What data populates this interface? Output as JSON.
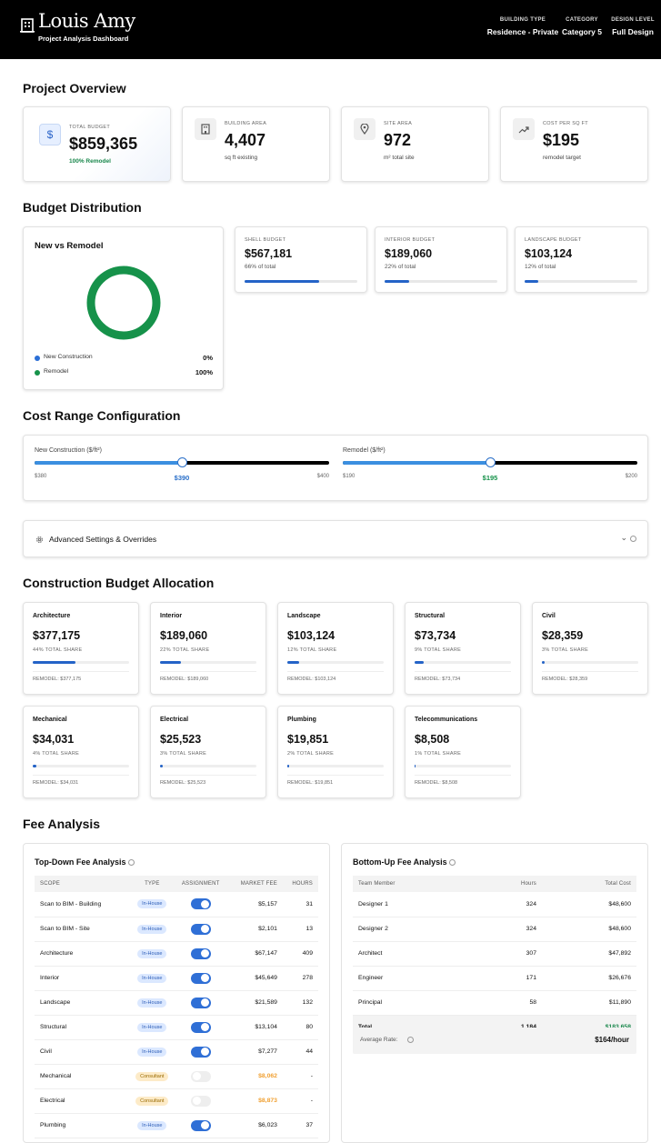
{
  "header": {
    "brand": "Louis Amy",
    "subtitle": "Project Analysis Dashboard",
    "meta": [
      {
        "label": "BUILDING TYPE",
        "value": "Residence - Private"
      },
      {
        "label": "CATEGORY",
        "value": "Category 5"
      },
      {
        "label": "DESIGN LEVEL",
        "value": "Full Design"
      }
    ]
  },
  "overview": {
    "title": "Project Overview",
    "cards": [
      {
        "icon": "dollar-icon",
        "label": "TOTAL BUDGET",
        "value": "$859,365",
        "sub": "100% Remodel"
      },
      {
        "icon": "building-icon",
        "label": "BUILDING AREA",
        "value": "4,407",
        "sub": "sq ft existing"
      },
      {
        "icon": "map-pin-icon",
        "label": "SITE AREA",
        "value": "972",
        "sub": "m² total site"
      },
      {
        "icon": "trending-up-icon",
        "label": "COST PER SQ FT",
        "value": "$195",
        "sub": "remodel target"
      }
    ]
  },
  "budget": {
    "title": "Budget Distribution",
    "donut": {
      "title": "New vs Remodel",
      "legend": [
        {
          "label": "New Construction",
          "value": "0%",
          "color": "#2b6fd6"
        },
        {
          "label": "Remodel",
          "value": "100%",
          "color": "#16924a"
        }
      ],
      "new_fraction": 0,
      "remodel_fraction": 1
    },
    "cards": [
      {
        "label": "SHELL BUDGET",
        "value": "$567,181",
        "sub": "66% of total",
        "fraction": 0.66
      },
      {
        "label": "INTERIOR BUDGET",
        "value": "$189,060",
        "sub": "22% of total",
        "fraction": 0.22
      },
      {
        "label": "LANDSCAPE BUDGET",
        "value": "$103,124",
        "sub": "12% of total",
        "fraction": 0.12
      }
    ]
  },
  "cost_range": {
    "title": "Cost Range Configuration",
    "new": {
      "label": "New Construction ($/ft²)",
      "min": "$380",
      "max": "$400",
      "value": "$390",
      "fraction": 0.5
    },
    "remodel": {
      "label": "Remodel ($/ft²)",
      "min": "$190",
      "max": "$200",
      "value": "$195",
      "fraction": 0.5
    }
  },
  "advanced": {
    "label": "Advanced Settings & Overrides"
  },
  "allocation": {
    "title": "Construction Budget Allocation",
    "items": [
      {
        "name": "Architecture",
        "value": "$377,175",
        "share": "44% TOTAL SHARE",
        "remodel": "REMODEL: $377,175",
        "fraction": 0.44
      },
      {
        "name": "Interior",
        "value": "$189,060",
        "share": "22% TOTAL SHARE",
        "remodel": "REMODEL: $189,060",
        "fraction": 0.22
      },
      {
        "name": "Landscape",
        "value": "$103,124",
        "share": "12% TOTAL SHARE",
        "remodel": "REMODEL: $103,124",
        "fraction": 0.12
      },
      {
        "name": "Structural",
        "value": "$73,734",
        "share": "9% TOTAL SHARE",
        "remodel": "REMODEL: $73,734",
        "fraction": 0.09
      },
      {
        "name": "Civil",
        "value": "$28,359",
        "share": "3% TOTAL SHARE",
        "remodel": "REMODEL: $28,359",
        "fraction": 0.03
      },
      {
        "name": "Mechanical",
        "value": "$34,031",
        "share": "4% TOTAL SHARE",
        "remodel": "REMODEL: $34,031",
        "fraction": 0.04
      },
      {
        "name": "Electrical",
        "value": "$25,523",
        "share": "3% TOTAL SHARE",
        "remodel": "REMODEL: $25,523",
        "fraction": 0.03
      },
      {
        "name": "Plumbing",
        "value": "$19,851",
        "share": "2% TOTAL SHARE",
        "remodel": "REMODEL: $19,851",
        "fraction": 0.02
      },
      {
        "name": "Telecommunications",
        "value": "$8,508",
        "share": "1% TOTAL SHARE",
        "remodel": "REMODEL: $8,508",
        "fraction": 0.01
      }
    ]
  },
  "fee": {
    "title": "Fee Analysis",
    "topdown": {
      "title": "Top-Down Fee Analysis",
      "columns": [
        "SCOPE",
        "TYPE",
        "ASSIGNMENT",
        "MARKET FEE",
        "HOURS"
      ],
      "rows": [
        {
          "scope": "Scan to BIM - Building",
          "type": "In-House",
          "on": true,
          "fee": "$5,157",
          "hours": "31"
        },
        {
          "scope": "Scan to BIM - Site",
          "type": "In-House",
          "on": true,
          "fee": "$2,101",
          "hours": "13"
        },
        {
          "scope": "Architecture",
          "type": "In-House",
          "on": true,
          "fee": "$67,147",
          "hours": "409"
        },
        {
          "scope": "Interior",
          "type": "In-House",
          "on": true,
          "fee": "$45,649",
          "hours": "278"
        },
        {
          "scope": "Landscape",
          "type": "In-House",
          "on": true,
          "fee": "$21,589",
          "hours": "132"
        },
        {
          "scope": "Structural",
          "type": "In-House",
          "on": true,
          "fee": "$13,104",
          "hours": "80"
        },
        {
          "scope": "Civil",
          "type": "In-House",
          "on": true,
          "fee": "$7,277",
          "hours": "44"
        },
        {
          "scope": "Mechanical",
          "type": "Consultant",
          "on": false,
          "fee": "$8,062",
          "hours": "-"
        },
        {
          "scope": "Electrical",
          "type": "Consultant",
          "on": false,
          "fee": "$8,873",
          "hours": "-"
        },
        {
          "scope": "Plumbing",
          "type": "In-House",
          "on": true,
          "fee": "$6,023",
          "hours": "37"
        }
      ]
    },
    "bottomup": {
      "title": "Bottom-Up Fee Analysis",
      "columns": [
        "Team Member",
        "Hours",
        "Total Cost"
      ],
      "rows": [
        {
          "member": "Designer 1",
          "hours": "324",
          "cost": "$48,600"
        },
        {
          "member": "Designer 2",
          "hours": "324",
          "cost": "$48,600"
        },
        {
          "member": "Architect",
          "hours": "307",
          "cost": "$47,892"
        },
        {
          "member": "Engineer",
          "hours": "171",
          "cost": "$26,676"
        },
        {
          "member": "Principal",
          "hours": "58",
          "cost": "$11,890"
        }
      ],
      "total": {
        "label": "Total",
        "hours": "1,184",
        "cost": "$183,658"
      },
      "avg": {
        "label": "Average Rate:",
        "value": "$164/hour"
      }
    }
  }
}
